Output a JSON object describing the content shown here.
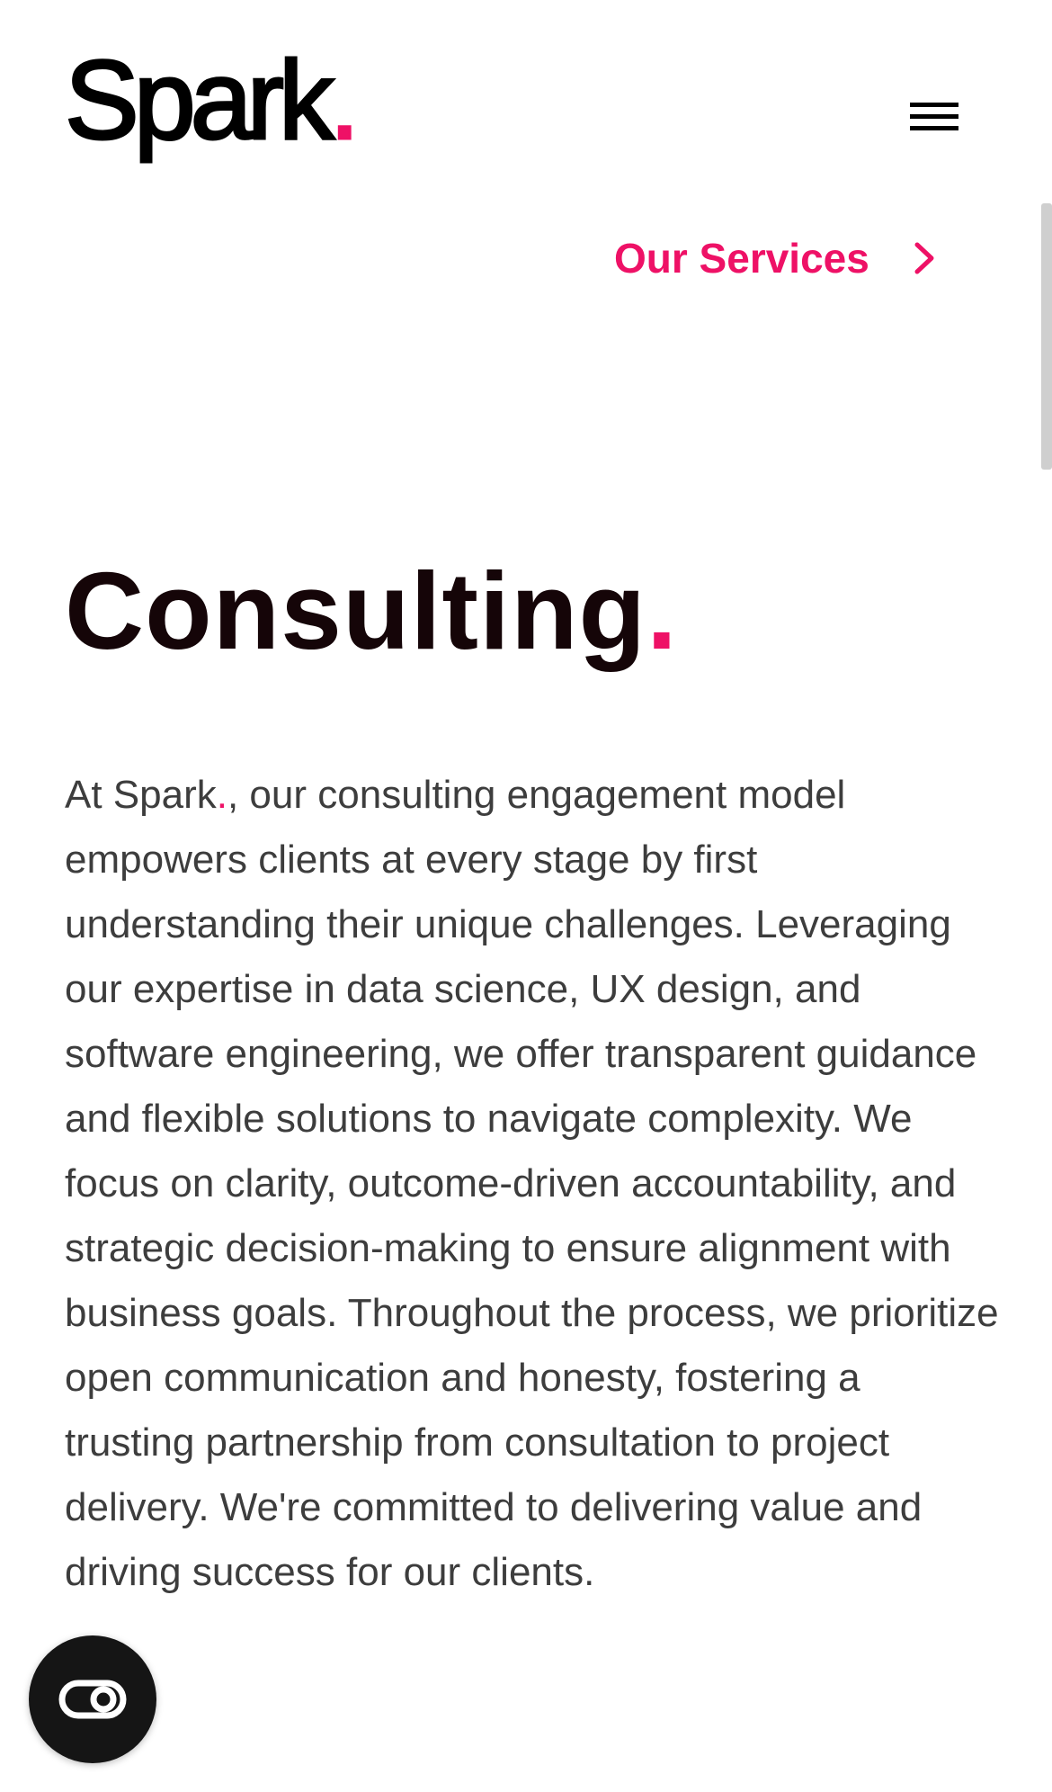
{
  "header": {
    "logo_text": "Spark",
    "logo_dot": ".",
    "menu_icon": "hamburger-menu-icon"
  },
  "nav": {
    "services_label": "Our Services",
    "services_icon": "chevron-right-icon"
  },
  "main": {
    "title": "Consulting",
    "title_dot": ".",
    "body_prefix": "At Spark",
    "body_dot": ".",
    "body_rest": ", our consulting engagement model empowers clients at every stage by first understanding their unique challenges. Leveraging our expertise in data science, UX design, and software engineering, we offer transparent guidance and flexible solutions to navigate complexity. We focus on clarity, outcome-driven accountability, and strategic decision-making to ensure alignment with business goals. Throughout the process, we prioritize open communication and honesty, fostering a trusting partnership from consultation to project delivery. We're committed to delivering value and driving success for our clients."
  },
  "floating_button": {
    "icon": "toggle-switch-icon"
  },
  "colors": {
    "accent": "#ee1166",
    "title": "#150508",
    "body": "#3d3d3d",
    "fab_background": "#151515"
  }
}
